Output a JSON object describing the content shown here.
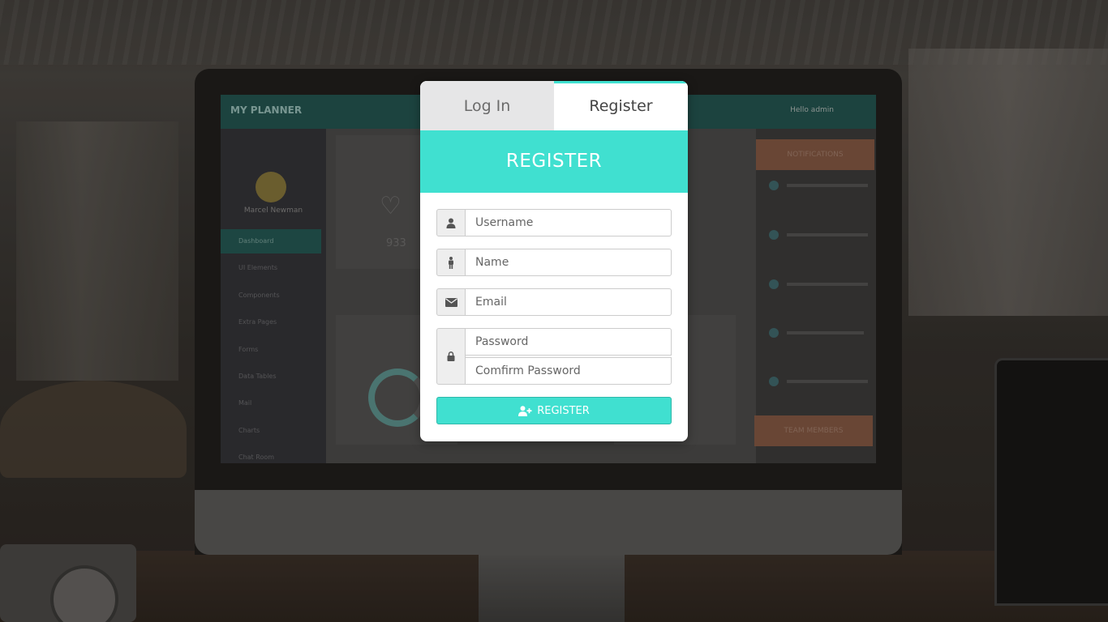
{
  "background_dashboard": {
    "brand": "MY PLANNER",
    "user_greeting": "Hello admin",
    "profile_name": "Marcel Newman",
    "nav_items": [
      "Dashboard",
      "UI Elements",
      "Components",
      "Extra Pages",
      "Forms",
      "Data Tables",
      "Mail",
      "Charts",
      "Chat Room"
    ],
    "stat_value": "933",
    "notifications_title": "NOTIFICATIONS",
    "team_title": "TEAM MEMBERS"
  },
  "modal": {
    "tabs": {
      "login": "Log In",
      "register": "Register"
    },
    "active_tab": "register",
    "title": "REGISTER",
    "fields": {
      "username": {
        "placeholder": "Username",
        "value": "",
        "icon": "user-icon"
      },
      "name": {
        "placeholder": "Name",
        "value": "",
        "icon": "person-icon"
      },
      "email": {
        "placeholder": "Email",
        "value": "",
        "icon": "envelope-icon"
      },
      "password": {
        "placeholder": "Password",
        "value": "",
        "icon": "lock-icon"
      },
      "confirm_password": {
        "placeholder": "Comfirm Password",
        "value": ""
      }
    },
    "submit_label": "REGISTER",
    "submit_icon": "user-plus-icon"
  },
  "colors": {
    "accent": "#40e0d0",
    "inactive_tab": "#e6e6e7",
    "addon_bg": "#eeeeee"
  }
}
